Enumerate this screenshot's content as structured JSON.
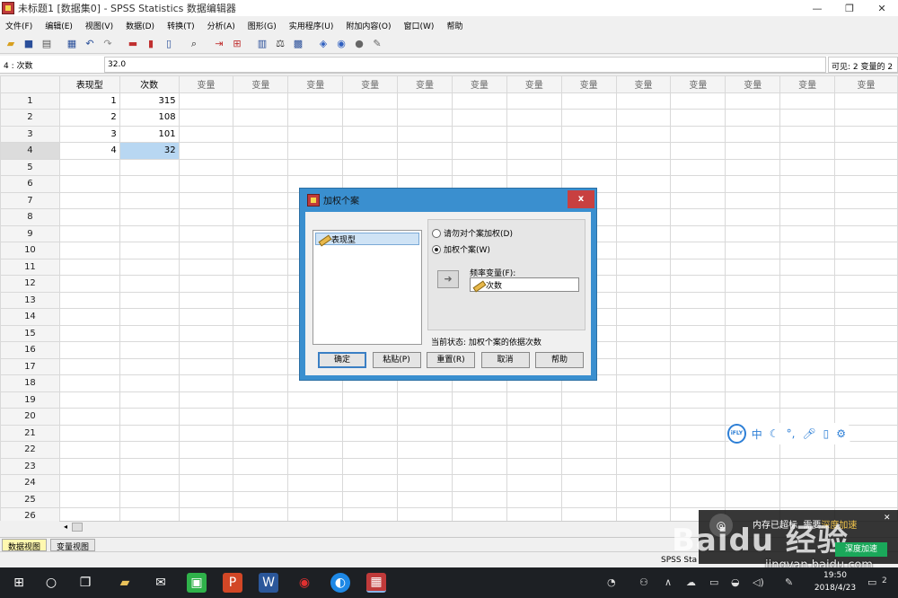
{
  "window": {
    "title": "未标题1 [数据集0] - SPSS Statistics 数据编辑器",
    "min_glyph": "—",
    "max_glyph": "❐",
    "close_glyph": "✕"
  },
  "menu": [
    "文件(F)",
    "编辑(E)",
    "视图(V)",
    "数据(D)",
    "转换(T)",
    "分析(A)",
    "图形(G)",
    "实用程序(U)",
    "附加内容(O)",
    "窗口(W)",
    "帮助"
  ],
  "cellbar": {
    "ref": "4 : 次数",
    "value": "32.0",
    "visible": "可见: 2 变量的 2"
  },
  "grid": {
    "columns": [
      "表现型",
      "次数"
    ],
    "empty_col_label": "变量",
    "rows": [
      {
        "n": "1",
        "c1": "1",
        "c2": "315"
      },
      {
        "n": "2",
        "c1": "2",
        "c2": "108"
      },
      {
        "n": "3",
        "c1": "3",
        "c2": "101"
      },
      {
        "n": "4",
        "c1": "4",
        "c2": "32"
      },
      {
        "n": "5",
        "c1": "",
        "c2": ""
      },
      {
        "n": "6",
        "c1": "",
        "c2": ""
      },
      {
        "n": "7",
        "c1": "",
        "c2": ""
      },
      {
        "n": "8",
        "c1": "",
        "c2": ""
      },
      {
        "n": "9",
        "c1": "",
        "c2": ""
      },
      {
        "n": "10",
        "c1": "",
        "c2": ""
      },
      {
        "n": "11",
        "c1": "",
        "c2": ""
      },
      {
        "n": "12",
        "c1": "",
        "c2": ""
      },
      {
        "n": "13",
        "c1": "",
        "c2": ""
      },
      {
        "n": "14",
        "c1": "",
        "c2": ""
      },
      {
        "n": "15",
        "c1": "",
        "c2": ""
      },
      {
        "n": "16",
        "c1": "",
        "c2": ""
      },
      {
        "n": "17",
        "c1": "",
        "c2": ""
      },
      {
        "n": "18",
        "c1": "",
        "c2": ""
      },
      {
        "n": "19",
        "c1": "",
        "c2": ""
      },
      {
        "n": "20",
        "c1": "",
        "c2": ""
      },
      {
        "n": "21",
        "c1": "",
        "c2": ""
      },
      {
        "n": "22",
        "c1": "",
        "c2": ""
      },
      {
        "n": "23",
        "c1": "",
        "c2": ""
      },
      {
        "n": "24",
        "c1": "",
        "c2": ""
      },
      {
        "n": "25",
        "c1": "",
        "c2": ""
      },
      {
        "n": "26",
        "c1": "",
        "c2": ""
      }
    ]
  },
  "view_tabs": {
    "data_view": "数据视图",
    "variable_view": "变量视图"
  },
  "status": {
    "processor": "SPSS Sta"
  },
  "dialog": {
    "title": "加权个案",
    "close": "x",
    "source_var": "表现型",
    "opt_no_weight": "请勿对个案加权(D)",
    "opt_weight": "加权个案(W)",
    "freq_label": "频率变量(F):",
    "freq_value": "次数",
    "current_status": "当前状态: 加权个案的依据次数",
    "buttons": {
      "ok": "确定",
      "paste": "粘贴(P)",
      "reset": "重置(R)",
      "cancel": "取消",
      "help": "帮助"
    }
  },
  "ime": {
    "logo": "iFLY",
    "mode": "中"
  },
  "overlay": {
    "line1": "内存已超标",
    "line2": "需要",
    "line2_hl": "深度加速",
    "button": "深度加速",
    "brand": "Baidu 经验",
    "url": "jingyan.baidu.com"
  },
  "taskbar": {
    "time": "19:50",
    "date": "2018/4/23",
    "notif_count": "2"
  },
  "colors": {
    "accent": "#3a8fcf",
    "selection": "#b8d7f2",
    "taskbar": "#1d2024",
    "active_tab": "#fff8b0"
  }
}
